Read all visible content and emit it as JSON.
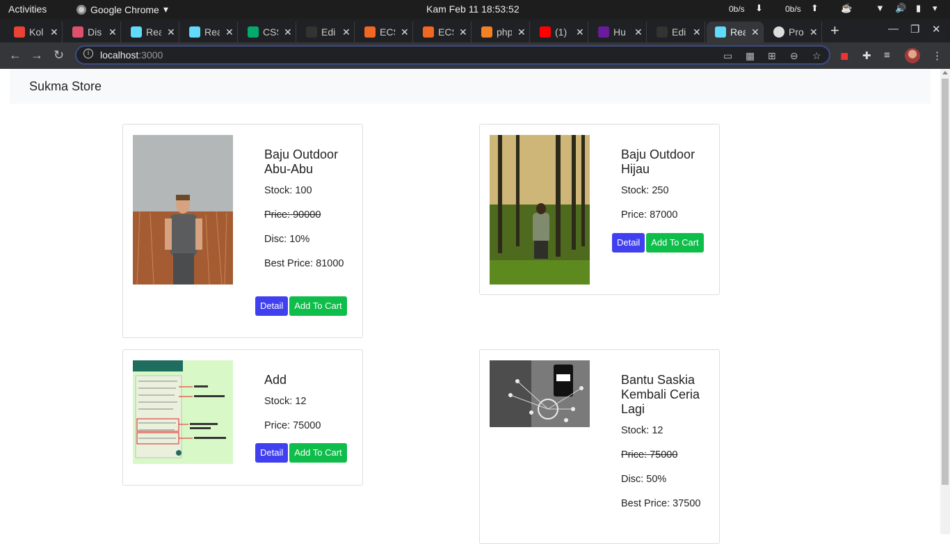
{
  "system": {
    "activities": "Activities",
    "app_name": "Google Chrome",
    "clock": "Kam Feb 11  18:53:52",
    "net_down": "0b/s",
    "net_up": "0b/s"
  },
  "browser": {
    "tabs": [
      {
        "label": "Kol",
        "color": "#ea4335"
      },
      {
        "label": "Dis",
        "color": "#e0506c"
      },
      {
        "label": "Rea",
        "color": "#61dafb"
      },
      {
        "label": "Rea",
        "color": "#61dafb"
      },
      {
        "label": "CSS",
        "color": "#04aa6d"
      },
      {
        "label": "Edi",
        "color": "#333333"
      },
      {
        "label": "ECS",
        "color": "#f26722"
      },
      {
        "label": "ECS",
        "color": "#f26722"
      },
      {
        "label": "php",
        "color": "#f48024"
      },
      {
        "label": "(1)",
        "color": "#ff0000"
      },
      {
        "label": "Hu",
        "color": "#6a1b9a"
      },
      {
        "label": "Edi",
        "color": "#333333"
      },
      {
        "label": "Rea",
        "color": "#61dafb",
        "active": true
      },
      {
        "label": "Pro",
        "color": "#dddddd"
      }
    ],
    "url_host": "localhost",
    "url_port": ":3000"
  },
  "page": {
    "brand": "Sukma Store",
    "products": [
      {
        "name": "Baju Outdoor Abu-Abu",
        "stock": "Stock: 100",
        "price": "Price: 90000",
        "disc": "Disc: 10%",
        "best_price": "Best Price: 81000",
        "detail_label": "Detail",
        "cart_label": "Add To Cart"
      },
      {
        "name": "Baju Outdoor Hijau",
        "stock": "Stock: 250",
        "price": "Price: 87000",
        "detail_label": "Detail",
        "cart_label": "Add To Cart"
      },
      {
        "name": "Add",
        "stock": "Stock: 12",
        "price": "Price: 75000",
        "detail_label": "Detail",
        "cart_label": "Add To Cart"
      },
      {
        "name": "Bantu Saskia Kembali Ceria Lagi",
        "stock": "Stock: 12",
        "price": "Price: 75000",
        "disc": "Disc: 50%",
        "best_price": "Best Price: 37500"
      }
    ]
  },
  "colors": {
    "detail_button": "#4040f0",
    "cart_button": "#0fbd4a"
  }
}
